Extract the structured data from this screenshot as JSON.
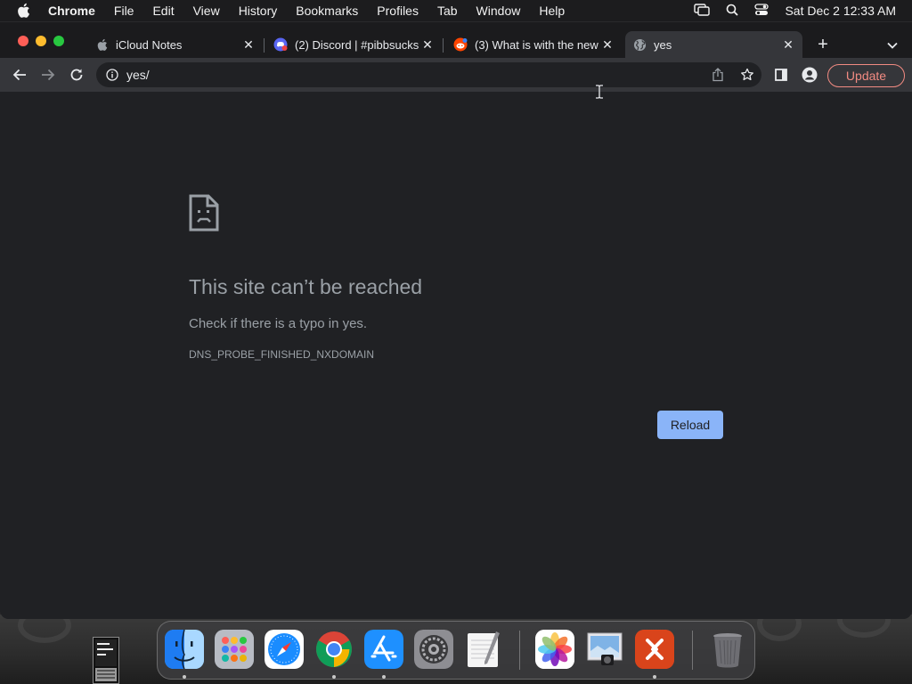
{
  "menubar": {
    "app_name": "Chrome",
    "menus": [
      "File",
      "Edit",
      "View",
      "History",
      "Bookmarks",
      "Profiles",
      "Tab",
      "Window",
      "Help"
    ],
    "clock": "Sat Dec 2  12:33 AM"
  },
  "tabs": [
    {
      "title": "iCloud Notes",
      "icon": "apple-icon",
      "active": false
    },
    {
      "title": "(2) Discord | #pibbsucks",
      "icon": "discord-icon",
      "active": false
    },
    {
      "title": "(3) What is with the new",
      "icon": "reddit-icon",
      "active": false
    },
    {
      "title": "yes",
      "icon": "globe-icon",
      "active": true
    }
  ],
  "toolbar": {
    "url": "yes/",
    "update_label": "Update"
  },
  "error_page": {
    "title": "This site can’t be reached",
    "description": "Check if there is a typo in yes.",
    "code": "DNS_PROBE_FINISHED_NXDOMAIN",
    "reload_label": "Reload"
  },
  "dock": {
    "apps": [
      "Finder",
      "Launchpad",
      "Safari",
      "Google Chrome",
      "App Store",
      "System Settings",
      "TextEdit",
      "Photos",
      "Preview",
      "Microsoft Remote Desktop",
      "Trash"
    ]
  },
  "colors": {
    "accent_blue": "#8ab4f8",
    "update_red": "#f28b82",
    "page_bg": "#202124"
  }
}
